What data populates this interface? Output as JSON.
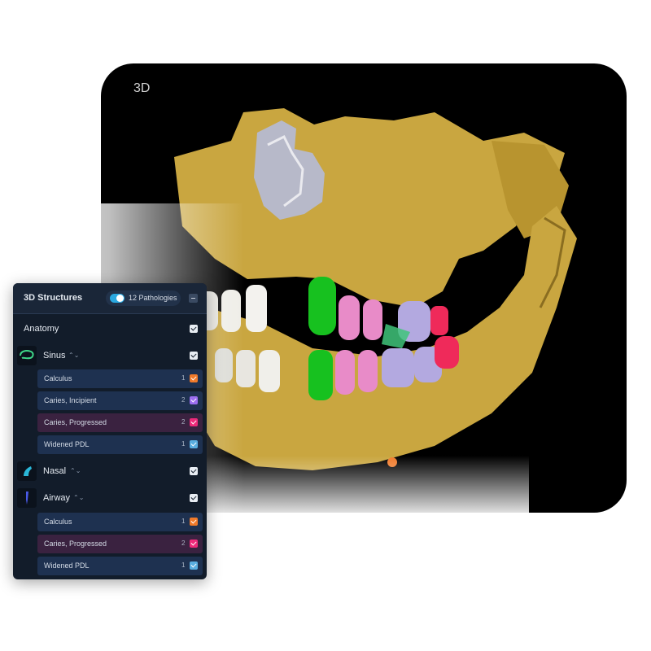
{
  "viewer": {
    "label": "3D",
    "background": "#000000",
    "bone_color": "#c9a640",
    "sinus_color": "#b7b9c9"
  },
  "panel": {
    "title": "3D Structures",
    "pathologies_toggle": {
      "label": "12 Pathologies",
      "on": true
    },
    "anatomy": {
      "label": "Anatomy",
      "checked": true
    },
    "categories": [
      {
        "label": "Sinus",
        "icon": "sinus-outline-icon",
        "checked": true,
        "pathologies": [
          {
            "label": "Calculus",
            "count": "1",
            "color": "#f07a2a"
          },
          {
            "label": "Caries, Incipient",
            "count": "2",
            "color": "#9b6ef0"
          },
          {
            "label": "Caries, Progressed",
            "count": "2",
            "color": "#ee2a7a",
            "highlighted": true
          },
          {
            "label": "Widened PDL",
            "count": "1",
            "color": "#5aaee0"
          }
        ]
      },
      {
        "label": "Nasal",
        "icon": "nasal-icon",
        "checked": true,
        "pathologies": []
      },
      {
        "label": "Airway",
        "icon": "airway-icon",
        "checked": true,
        "pathologies": [
          {
            "label": "Calculus",
            "count": "1",
            "color": "#f07a2a"
          },
          {
            "label": "Caries, Progressed",
            "count": "2",
            "color": "#ee2a7a",
            "highlighted": true
          },
          {
            "label": "Widened PDL",
            "count": "1",
            "color": "#5aaee0"
          }
        ]
      }
    ]
  }
}
